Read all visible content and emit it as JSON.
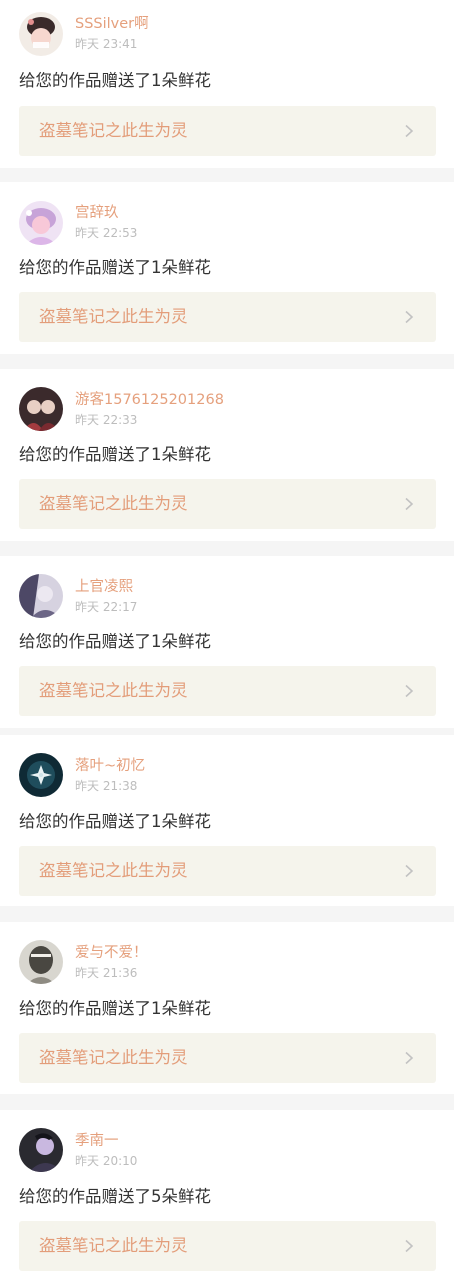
{
  "notifications": [
    {
      "username": "SSSilver啊",
      "time": "昨天 23:41",
      "message": "给您的作品赠送了1朵鲜花",
      "work_title": "盗墓笔记之此生为灵",
      "avatar_colors": [
        "#f2ece6",
        "#3a2a2a",
        "#f6d7cf"
      ]
    },
    {
      "username": "宫辞玖",
      "time": "昨天 22:53",
      "message": "给您的作品赠送了1朵鲜花",
      "work_title": "盗墓笔记之此生为灵",
      "avatar_colors": [
        "#efe3f4",
        "#c7a3d8",
        "#f8c8d8"
      ]
    },
    {
      "username": "游客1576125201268",
      "time": "昨天 22:33",
      "message": "给您的作品赠送了1朵鲜花",
      "work_title": "盗墓笔记之此生为灵",
      "avatar_colors": [
        "#3b2a2c",
        "#a33b3f",
        "#e8cfc4"
      ]
    },
    {
      "username": "上官凌熙",
      "time": "昨天 22:17",
      "message": "给您的作品赠送了1朵鲜花",
      "work_title": "盗墓笔记之此生为灵",
      "avatar_colors": [
        "#d6d2e0",
        "#4d4866",
        "#ece8f1"
      ]
    },
    {
      "username": "落叶~初忆",
      "time": "昨天 21:38",
      "message": "给您的作品赠送了1朵鲜花",
      "work_title": "盗墓笔记之此生为灵",
      "avatar_colors": [
        "#0f2a35",
        "#1f4d5c",
        "#e9f2f4"
      ]
    },
    {
      "username": "爱与不爱！",
      "time": "昨天 21:36",
      "message": "给您的作品赠送了1朵鲜花",
      "work_title": "盗墓笔记之此生为灵",
      "avatar_colors": [
        "#d8d6cf",
        "#494741",
        "#f1efe9"
      ]
    },
    {
      "username": "季南一",
      "time": "昨天 20:10",
      "message": "给您的作品赠送了5朵鲜花",
      "work_title": "盗墓笔记之此生为灵",
      "avatar_colors": [
        "#2a2a30",
        "#3d3850",
        "#c9b8e0"
      ]
    }
  ],
  "colors": {
    "username": "#e5a07d",
    "work_title": "#e39d7a",
    "work_bg": "#f5f4ec",
    "separator": "#f5f5f5"
  },
  "icons": {
    "chevron": "chevron-right-icon"
  }
}
